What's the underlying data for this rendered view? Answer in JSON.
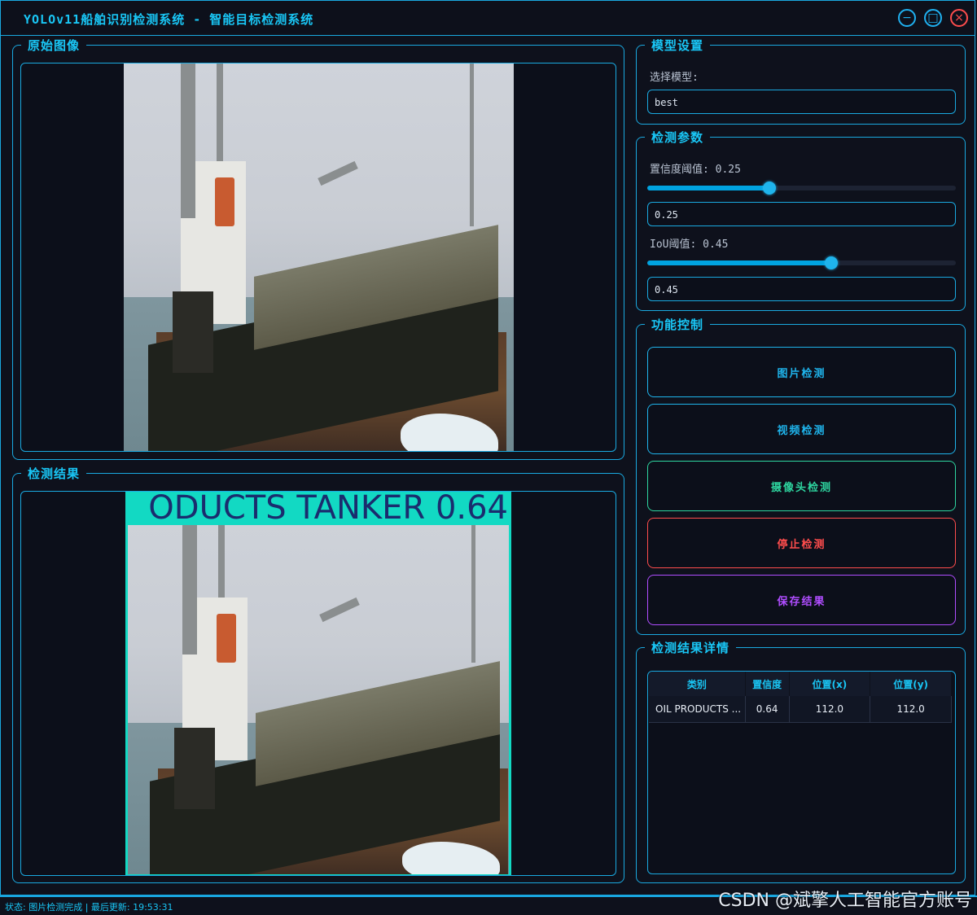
{
  "window": {
    "title": "YOLOv11船舶识别检测系统 - 智能目标检测系统",
    "minimize_glyph": "−",
    "maximize_glyph": "□",
    "close_glyph": "×"
  },
  "original_image": {
    "title": "原始图像"
  },
  "detection_result": {
    "title": "检测结果",
    "box_label": "ODUCTS TANKER 0.64"
  },
  "model_settings": {
    "title": "模型设置",
    "select_label": "选择模型:",
    "model_value": "best"
  },
  "detection_params": {
    "title": "检测参数",
    "confidence_label": "置信度阈值: 0.25",
    "confidence_value": "0.25",
    "confidence_fraction": 0.25,
    "iou_label": "IoU阈值: 0.45",
    "iou_value": "0.45",
    "iou_fraction": 0.45
  },
  "function_control": {
    "title": "功能控制",
    "buttons": [
      {
        "label": "图片检测",
        "color": "#1fb4ec"
      },
      {
        "label": "视频检测",
        "color": "#1fb4ec"
      },
      {
        "label": "摄像头检测",
        "color": "#2ed6a0"
      },
      {
        "label": "停止检测",
        "color": "#ff4d4d"
      },
      {
        "label": "保存结果",
        "color": "#b04dff"
      }
    ]
  },
  "result_details": {
    "title": "检测结果详情",
    "columns": [
      "类别",
      "置信度",
      "位置(x)",
      "位置(y)"
    ],
    "rows": [
      [
        "OIL PRODUCTS ...",
        "0.64",
        "112.0",
        "112.0"
      ]
    ]
  },
  "status": {
    "text": "状态: 图片检测完成 | 最后更新: 19:53:31"
  },
  "watermark": "CSDN @斌擎人工智能官方账号"
}
